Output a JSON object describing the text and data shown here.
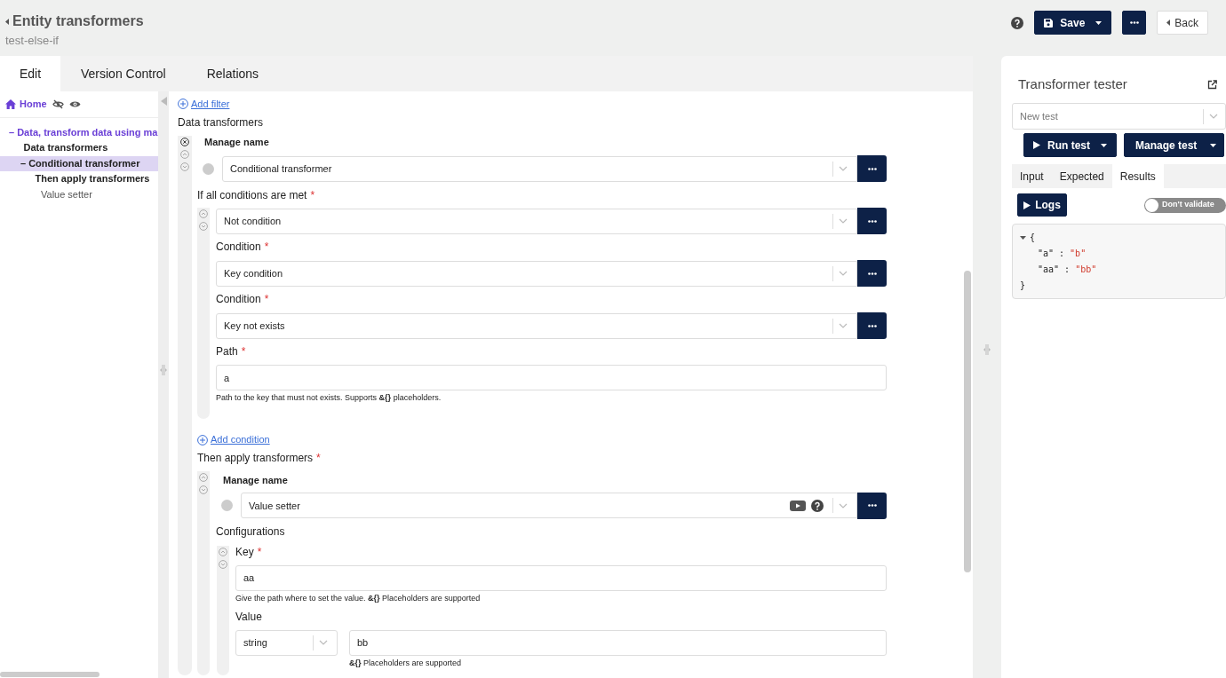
{
  "header": {
    "title": "Entity transformers",
    "subtitle": "test-else-if"
  },
  "toolbar": {
    "save": "Save",
    "back": "Back"
  },
  "tabs": [
    {
      "label": "Edit",
      "selected": true
    },
    {
      "label": "Version Control",
      "selected": false
    },
    {
      "label": "Relations",
      "selected": false
    }
  ],
  "sidebar": {
    "home": "Home",
    "tree": [
      {
        "marker": "–",
        "label": "Data, transform data using ma",
        "selected": false,
        "children": [
          {
            "label": "Data transformers",
            "selected": false,
            "children": [
              {
                "marker": "–",
                "label": "Conditional transformer",
                "selected": true,
                "children": [
                  {
                    "label": "Then apply transformers",
                    "selected": false,
                    "children": [
                      {
                        "label": "Value setter",
                        "selected": false
                      }
                    ]
                  }
                ]
              }
            ]
          }
        ]
      }
    ]
  },
  "editor": {
    "add_filter": "Add filter",
    "section": "Data transformers",
    "transformer": {
      "name_label": "Manage name",
      "name": "Conditional transformer",
      "conditions_label": "If all conditions are met",
      "conditions_required": "*",
      "condition": {
        "type": "Not condition",
        "fields": [
          {
            "kind": "select",
            "label": "Condition",
            "required": "*",
            "value": "Key condition"
          },
          {
            "kind": "select",
            "label": "Condition",
            "required": "*",
            "value": "Key not exists"
          },
          {
            "kind": "text",
            "label": "Path",
            "required": "*",
            "value": "a",
            "help": "Path to the key that must not exists. Supports **&{}** placeholders."
          }
        ]
      },
      "add_condition": "Add condition",
      "then_label": "Then apply transformers",
      "then_required": "*",
      "then": {
        "name_label": "Manage name",
        "name": "Value setter",
        "config_label": "Configurations",
        "fields": [
          {
            "kind": "text",
            "label": "Key",
            "required": "*",
            "value": "aa",
            "help": "Give the path where to set the value. **&{}** Placeholders are supported"
          },
          {
            "kind": "typed",
            "label": "Value",
            "type": "string",
            "value": "bb",
            "help": "**&{}** Placeholders are supported"
          }
        ]
      }
    }
  },
  "tester": {
    "title": "Transformer tester",
    "test": "New test",
    "run": "Run test",
    "manage": "Manage test",
    "tabs": [
      {
        "label": "Input",
        "selected": false
      },
      {
        "label": "Expected",
        "selected": false
      },
      {
        "label": "Results",
        "selected": true
      }
    ],
    "logs": "Logs",
    "validate": {
      "label": "Don't validate",
      "on": false
    },
    "result": {
      "open": "{",
      "close": "}",
      "entries": [
        {
          "key": "\"a\"",
          "colon": ":",
          "value": "\"b\""
        },
        {
          "key": "\"aa\"",
          "colon": ":",
          "value": "\"bb\""
        }
      ]
    }
  }
}
